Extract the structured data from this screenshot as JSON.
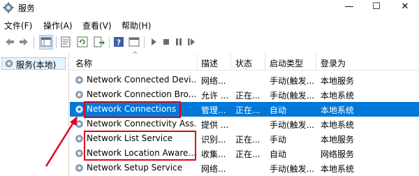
{
  "window": {
    "title": "服务",
    "minimize": "—",
    "maximize": "☐",
    "close": "✕"
  },
  "menu": [
    {
      "label": "文件(F)"
    },
    {
      "label": "操作(A)"
    },
    {
      "label": "查看(V)"
    },
    {
      "label": "帮助(H)"
    }
  ],
  "toolbar": {
    "icons": [
      "back-arrow-icon",
      "forward-arrow-icon",
      "console-tree-icon",
      "properties-icon",
      "refresh-icon",
      "export-icon",
      "help-icon",
      "view-icon",
      "start-icon",
      "stop-icon",
      "pause-icon",
      "restart-icon"
    ]
  },
  "tree": {
    "label": "服务(本地)"
  },
  "columns": {
    "name": "名称",
    "desc": "描述",
    "status": "状态",
    "startup": "启动类型",
    "logon": "登录为"
  },
  "rows": [
    {
      "name": "Network Connected Devi...",
      "desc": "网络...",
      "status": "",
      "startup": "手动(触发...",
      "logon": "本地服务",
      "selected": false
    },
    {
      "name": "Network Connection Bro...",
      "desc": "允许 ...",
      "status": "正在...",
      "startup": "手动(触发...",
      "logon": "本地系统",
      "selected": false
    },
    {
      "name": "Network Connections",
      "desc": "管理...",
      "status": "正在...",
      "startup": "自动",
      "logon": "本地系统",
      "selected": true
    },
    {
      "name": "Network Connectivity Ass...",
      "desc": "提供 ...",
      "status": "",
      "startup": "手动(触发...",
      "logon": "本地系统",
      "selected": false
    },
    {
      "name": "Network List Service",
      "desc": "识别...",
      "status": "正在...",
      "startup": "手动",
      "logon": "本地服务",
      "selected": false
    },
    {
      "name": "Network Location Aware...",
      "desc": "收集...",
      "status": "正在...",
      "startup": "自动",
      "logon": "网络服务",
      "selected": false
    },
    {
      "name": "Network Setup Service",
      "desc": "网络...",
      "status": "",
      "startup": "手动(触发...",
      "logon": "本地系统",
      "selected": false
    }
  ],
  "colors": {
    "selection": "#0078d7",
    "annotation": "#e0001a"
  }
}
